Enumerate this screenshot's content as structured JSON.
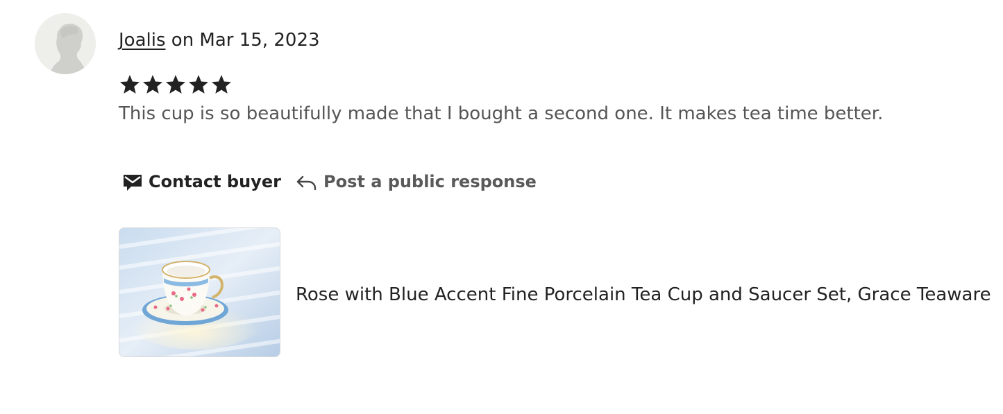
{
  "review": {
    "reviewer_name": "Joalis",
    "date_text": " on Mar 15, 2023",
    "rating": 5,
    "max_rating": 5,
    "text": "This cup is so beautifully made that I bought a second one. It makes tea time better."
  },
  "actions": {
    "contact_buyer_label": "Contact buyer",
    "post_response_label": "Post a public response"
  },
  "listing": {
    "title": "Rose with Blue Accent Fine Porcelain Tea Cup and Saucer Set, Grace Teaware"
  },
  "colors": {
    "primary_text": "#222222",
    "secondary_text": "#595959",
    "review_text": "#555555",
    "star": "#222222",
    "avatar_bg": "#eeeeea"
  },
  "icons": {
    "avatar": "default-avatar-icon",
    "star": "star-icon",
    "contact": "envelope-icon",
    "reply": "reply-arrow-icon"
  }
}
